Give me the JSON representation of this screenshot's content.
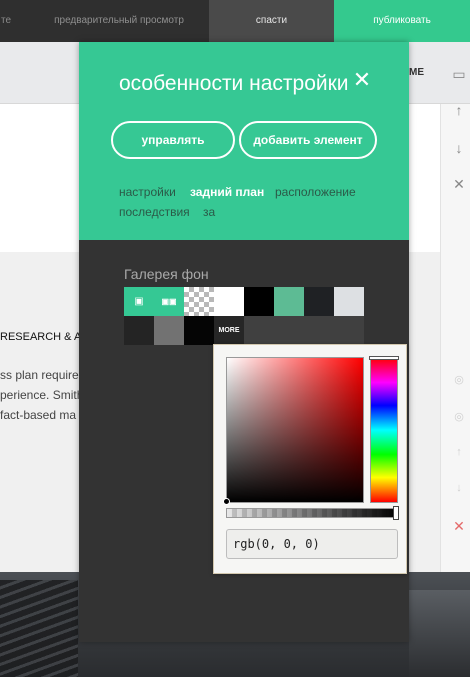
{
  "topbar": {
    "prev_cut": "те",
    "preview": "предварительный просмотр",
    "save": "спасти",
    "publish": "публиковать"
  },
  "background": {
    "bar_text": "МЕ",
    "heading": "RESEARCH & A",
    "line1": "ss plan requires",
    "line2": "perience. Smith",
    "line3": "fact-based ma"
  },
  "panel": {
    "title": "особенности настройки",
    "close_icon": "close-icon",
    "buttons": {
      "manage": "управлять",
      "add_element": "добавить элемент"
    },
    "tabs": [
      {
        "label": "настройки",
        "active": false
      },
      {
        "label": "задний план",
        "active": true
      },
      {
        "label": "расположение",
        "active": false
      },
      {
        "label": "последствия",
        "active": false
      },
      {
        "label": "за",
        "active": false
      }
    ],
    "gallery": {
      "label": "Галерея фон",
      "more": "MORE",
      "swatch_colors": [
        "#35c894",
        "#35c894",
        "transparent",
        "#ffffff",
        "#000000",
        "#5dbb94",
        "#1f2124",
        "#dde0e3",
        "#242424",
        "#727272",
        "#050505"
      ]
    }
  },
  "color_picker": {
    "value": "rgb(0, 0, 0)",
    "hue": "#ff0000"
  },
  "colors": {
    "accent": "#36c894",
    "topbar": "#2f2f2f",
    "panel_bg": "#333333"
  }
}
